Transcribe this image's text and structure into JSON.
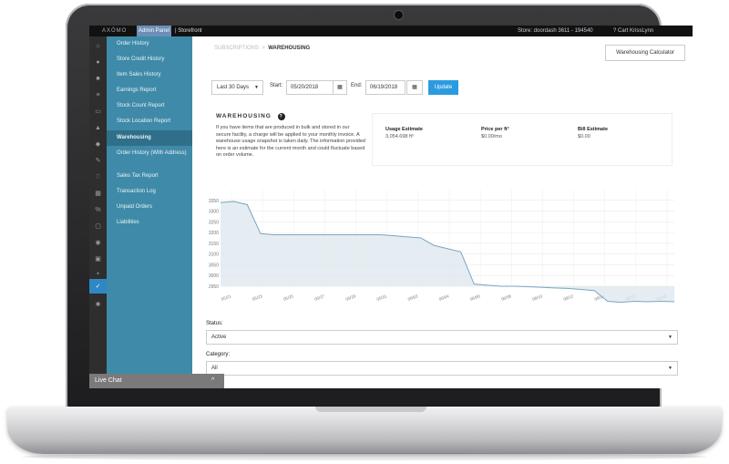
{
  "topbar": {
    "logo": "AXÓMO",
    "admin": "Admin Panel",
    "storefront": "| Storefront",
    "store_id": "Store: doordash 3611 - 194540",
    "right": "?    Cart    KrissLynn"
  },
  "sidebar": {
    "items": [
      {
        "label": "Order History"
      },
      {
        "label": "Store Credit History"
      },
      {
        "label": "Item Sales History"
      },
      {
        "label": "Earnings Report"
      },
      {
        "label": "Stock Count Report"
      },
      {
        "label": "Stock Location Report"
      },
      {
        "label": "Warehousing"
      },
      {
        "label": "Order History (With Address)"
      },
      {
        "label": "Sales Tax Report"
      },
      {
        "label": "Transaction Log"
      },
      {
        "label": "Unpaid Orders"
      },
      {
        "label": "Liabilities"
      }
    ]
  },
  "breadcrumb": {
    "parent": "SUBSCRIPTIONS",
    "sep": ">",
    "current": "WAREHOUSING"
  },
  "calc_button": "Warehousing Calculator",
  "filters": {
    "range": "Last 30 Days",
    "start_label": "Start:",
    "start": "05/20/2018",
    "end_label": "End:",
    "end": "06/19/2018",
    "update": "Update"
  },
  "warehousing": {
    "title": "WAREHOUSING",
    "help": "?",
    "text": "If you have items that are produced in bulk and stored in our secure facility, a charge will be applied to your monthly invoice. A warehouse usage snapshot is taken daily. The information provided here is an estimate for the current month and could fluctuate based on order volume.",
    "usage_label": "Usage Estimate",
    "usage_value": "3,054.698 ft³",
    "price_label": "Price per ft³",
    "price_value": "$0.00/mo",
    "bill_label": "Bill Estimate",
    "bill_value": "$0.00"
  },
  "chart_data": {
    "type": "area",
    "x": [
      "05/20",
      "05/21",
      "05/22",
      "05/23",
      "05/24",
      "05/25",
      "05/26",
      "05/27",
      "05/28",
      "05/29",
      "05/30",
      "05/31",
      "06/01",
      "06/02",
      "06/03",
      "06/04",
      "06/05",
      "06/06",
      "06/07",
      "06/08",
      "06/09",
      "06/10",
      "06/11",
      "06/12",
      "06/13",
      "06/14",
      "06/15",
      "06/16",
      "06/17",
      "06/18",
      "06/19"
    ],
    "x_tick_labels": [
      "05/21",
      "05/23",
      "05/25",
      "05/27",
      "05/29",
      "05/31",
      "06/02",
      "06/04",
      "06/06",
      "06/08",
      "06/10",
      "06/12",
      "06/14",
      "06/16",
      "06/18"
    ],
    "values": [
      3340,
      3345,
      3330,
      3195,
      3190,
      3190,
      3190,
      3190,
      3190,
      3190,
      3190,
      3190,
      3190,
      3185,
      3180,
      3175,
      3140,
      3125,
      3110,
      2960,
      2955,
      2950,
      2950,
      2948,
      2945,
      2942,
      2940,
      2935,
      2930,
      2880,
      2875,
      2880,
      2878,
      2880,
      2878
    ],
    "ylim": [
      2950,
      3400
    ],
    "yticks": [
      3350,
      3300,
      3250,
      3200,
      3150,
      3100,
      3050,
      3000,
      2950
    ],
    "grid": true
  },
  "status": {
    "label": "Status:",
    "value": "Active"
  },
  "category": {
    "label": "Category:",
    "value": "All"
  },
  "livechat": {
    "label": "Live Chat",
    "chevron": "^"
  }
}
